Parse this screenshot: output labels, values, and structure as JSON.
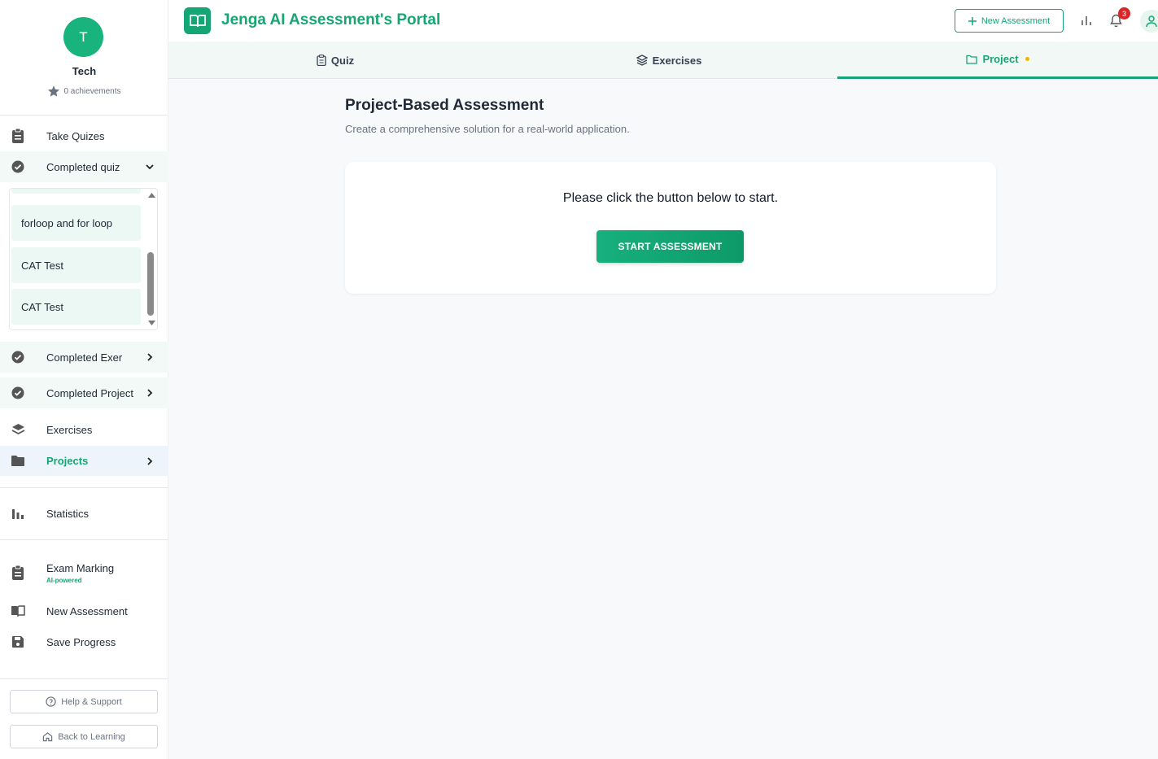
{
  "profile": {
    "initial": "T",
    "name": "Tech",
    "achievements": "0 achievements"
  },
  "sidebar": {
    "take_quizes": "Take Quizes",
    "completed_quiz": "Completed quiz",
    "completed_quiz_items": [
      "forloop and for loop",
      "CAT Test",
      "CAT Test"
    ],
    "completed_exer": "Completed Exer",
    "completed_project": "Completed Project",
    "exercises": "Exercises",
    "projects": "Projects",
    "statistics": "Statistics",
    "exam_marking": "Exam Marking",
    "exam_marking_badge": "AI-powered",
    "new_assessment": "New Assessment",
    "save_progress": "Save Progress",
    "help_support": "Help & Support",
    "back_to_learning": "Back to Learning"
  },
  "header": {
    "title": "Jenga AI Assessment's Portal",
    "new_assessment": "New Assessment",
    "notification_count": "3"
  },
  "tabs": [
    {
      "label": "Quiz",
      "icon": "clipboard-icon",
      "active": false
    },
    {
      "label": "Exercises",
      "icon": "layers-icon",
      "active": false
    },
    {
      "label": "Project",
      "icon": "folder-icon",
      "active": true
    }
  ],
  "main": {
    "title": "Project-Based Assessment",
    "subtitle": "Create a comprehensive solution for a real-world application.",
    "card_text": "Please click the button below to start.",
    "start_button": "START ASSESSMENT"
  },
  "colors": {
    "accent": "#17a673",
    "badge": "#dc2626",
    "tab_dot": "#f5b400"
  }
}
